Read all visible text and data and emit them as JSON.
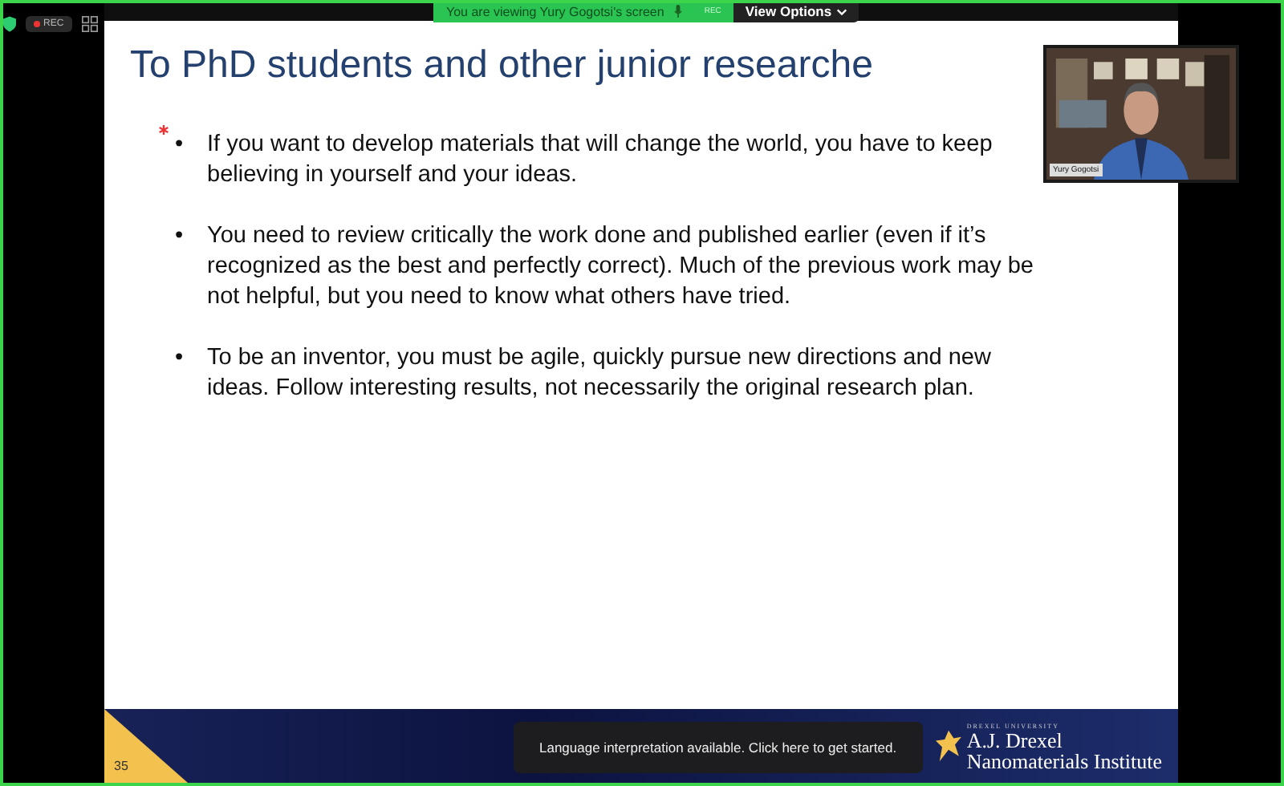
{
  "top_bar": {
    "rec_label": "REC",
    "banner": "You are viewing Yury Gogotsi's screen",
    "banner_rec": "REC",
    "view_options": "View Options"
  },
  "slide": {
    "title": "To PhD students and other junior researche",
    "bullets": [
      {
        "marker": "•",
        "text": "If you want to develop materials that will change the world, you have to keep believing in yourself and your ideas.",
        "starred": true
      },
      {
        "marker": "•",
        "text": "You need to review critically the work done and published earlier (even if it’s recognized as the best and perfectly correct). Much of the previous work may be not helpful, but you need to know what others have tried.",
        "starred": false
      },
      {
        "marker": "•",
        "text": "To be an inventor, you must be agile, quickly pursue new directions and new ideas. Follow interesting results, not necessarily the original research plan.",
        "starred": false
      }
    ],
    "page_number": "35",
    "logo_small": "DREXEL UNIVERSITY",
    "logo_line1": "A.J. Drexel",
    "logo_line2": "Nanomaterials Institute"
  },
  "video": {
    "name": "Yury Gogotsi"
  },
  "tooltip": "Language interpretation available. Click here to get started."
}
